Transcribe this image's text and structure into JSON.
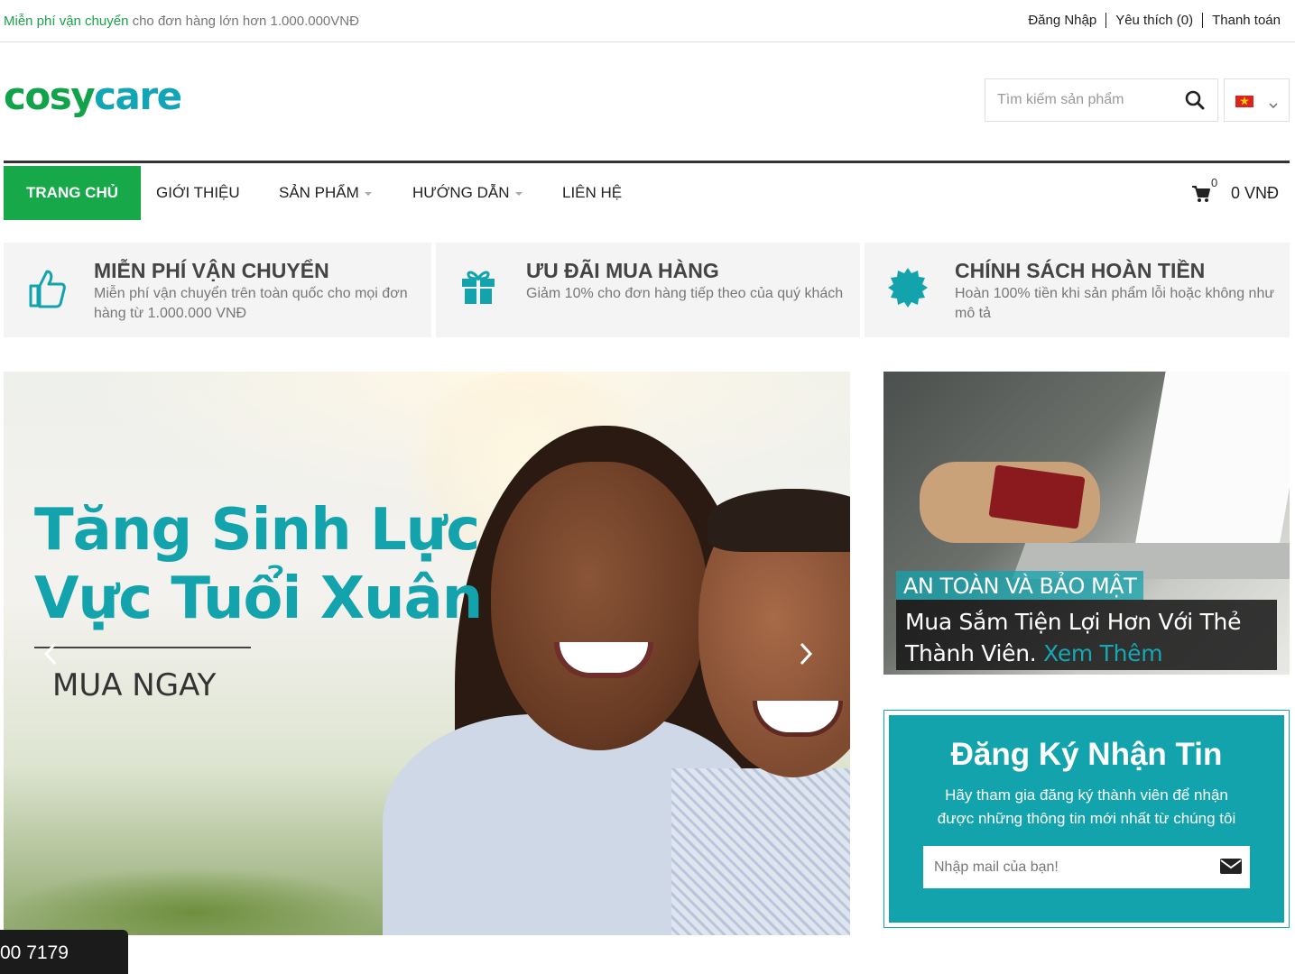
{
  "topbar": {
    "promo_highlight": "Miễn phí vận chuyển",
    "promo_rest": "cho đơn hàng lớn hơn 1.000.000VNĐ",
    "links": [
      "Đăng Nhập",
      "Yêu thích (0)",
      "Thanh toán"
    ]
  },
  "header": {
    "logo_part1": "cosy",
    "logo_part2": "care",
    "search_placeholder": "Tìm kiếm sản phẩm",
    "language": "vi-flag-icon"
  },
  "nav": {
    "items": [
      "TRANG CHỦ",
      "GIỚI THIỆU",
      "SẢN PHẨM",
      "HƯỚNG DẪN",
      "LIÊN HỆ"
    ],
    "cart_count": "0",
    "cart_total": "0 VNĐ"
  },
  "features": [
    {
      "icon": "thumbs-up-icon",
      "title": "MIỄN PHÍ VẬN CHUYỂN",
      "desc": "Miễn phí vận chuyển trên toàn quốc cho mọi đơn hàng từ 1.000.000 VNĐ"
    },
    {
      "icon": "gift-icon",
      "title": "ƯU ĐÃI MUA HÀNG",
      "desc": "Giảm 10% cho đơn hàng tiếp theo của quý khách"
    },
    {
      "icon": "badge-icon",
      "title": "CHÍNH SÁCH HOÀN TIỀN",
      "desc": "Hoàn 100% tiền khi sản phẩm lỗi hoặc không như mô tả"
    }
  ],
  "hero": {
    "line1": "Tăng Sinh Lực",
    "line2": "Vực Tuổi Xuân",
    "cta": "MUA NGAY"
  },
  "banner": {
    "tag": "AN TOÀN VÀ BẢO MẬT",
    "text": "Mua Sắm Tiện Lợi Hơn Với Thẻ Thành Viên.",
    "more": "Xem Thêm"
  },
  "newsletter": {
    "title": "Đăng Ký Nhận Tin",
    "desc": "Hãy tham gia đăng ký thành viên để nhận được những thông tin mới nhất từ chúng tôi",
    "placeholder": "Nhập mail của bạn!"
  },
  "hotline": "00 7179",
  "colors": {
    "green": "#17a84a",
    "teal": "#13a3ad"
  }
}
